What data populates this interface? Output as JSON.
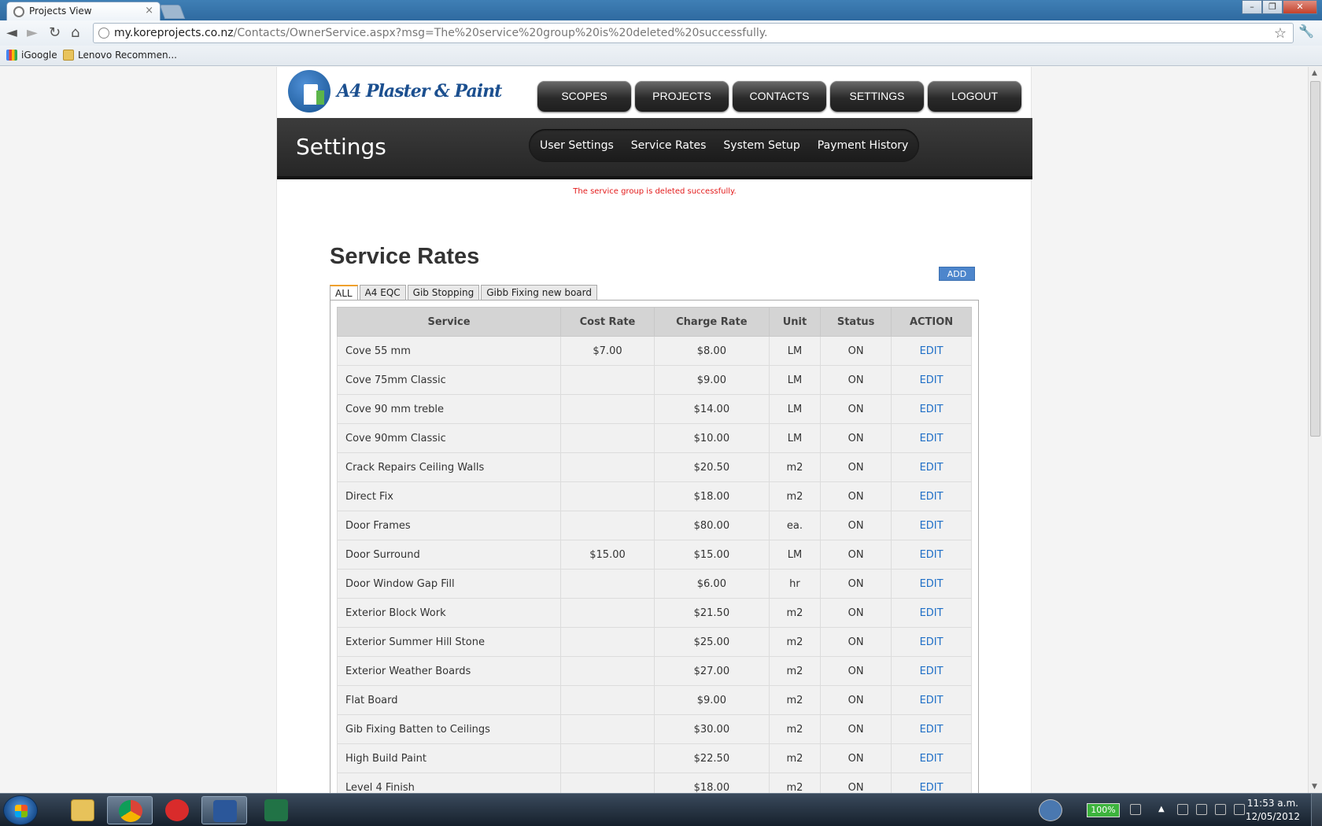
{
  "browser": {
    "tab_title": "Projects View",
    "tab_close": "×",
    "url_domain": "my.koreprojects.co.nz",
    "url_path": "/Contacts/OwnerService.aspx?msg=The%20service%20group%20is%20deleted%20successfully.",
    "bookmarks": [
      "iGoogle",
      "Lenovo Recommen..."
    ],
    "nav_icons": {
      "back": "◄",
      "forward": "►",
      "reload": "↻",
      "home": "⌂",
      "star": "☆",
      "wrench": "🔧"
    },
    "window_controls": [
      "–",
      "❐",
      "✕"
    ]
  },
  "site": {
    "logo_text": "A4 Plaster & Paint",
    "main_nav": [
      "SCOPES",
      "PROJECTS",
      "CONTACTS",
      "SETTINGS",
      "LOGOUT"
    ],
    "page_title": "Settings",
    "sub_nav": [
      "User Settings",
      "Service Rates",
      "System Setup",
      "Payment History"
    ],
    "message": "The service group is deleted successfully.",
    "message_color": "#e31b1b"
  },
  "rates": {
    "title": "Service Rates",
    "add_label": "ADD",
    "tabs": [
      "ALL",
      "A4 EQC",
      "Gib Stopping",
      "Gibb Fixing new board"
    ],
    "active_tab": "ALL",
    "columns": [
      "Service",
      "Cost Rate",
      "Charge Rate",
      "Unit",
      "Status",
      "ACTION"
    ],
    "rows": [
      {
        "service": "Cove 55 mm",
        "cost": "$7.00",
        "charge": "$8.00",
        "unit": "LM",
        "status": "ON",
        "action": "EDIT"
      },
      {
        "service": "Cove 75mm Classic",
        "cost": "",
        "charge": "$9.00",
        "unit": "LM",
        "status": "ON",
        "action": "EDIT"
      },
      {
        "service": "Cove 90 mm treble",
        "cost": "",
        "charge": "$14.00",
        "unit": "LM",
        "status": "ON",
        "action": "EDIT"
      },
      {
        "service": "Cove 90mm Classic",
        "cost": "",
        "charge": "$10.00",
        "unit": "LM",
        "status": "ON",
        "action": "EDIT"
      },
      {
        "service": "Crack Repairs Ceiling Walls",
        "cost": "",
        "charge": "$20.50",
        "unit": "m2",
        "status": "ON",
        "action": "EDIT"
      },
      {
        "service": "Direct Fix",
        "cost": "",
        "charge": "$18.00",
        "unit": "m2",
        "status": "ON",
        "action": "EDIT"
      },
      {
        "service": "Door Frames",
        "cost": "",
        "charge": "$80.00",
        "unit": "ea.",
        "status": "ON",
        "action": "EDIT"
      },
      {
        "service": "Door Surround",
        "cost": "$15.00",
        "charge": "$15.00",
        "unit": "LM",
        "status": "ON",
        "action": "EDIT"
      },
      {
        "service": "Door Window Gap Fill",
        "cost": "",
        "charge": "$6.00",
        "unit": "hr",
        "status": "ON",
        "action": "EDIT"
      },
      {
        "service": "Exterior Block Work",
        "cost": "",
        "charge": "$21.50",
        "unit": "m2",
        "status": "ON",
        "action": "EDIT"
      },
      {
        "service": "Exterior Summer Hill Stone",
        "cost": "",
        "charge": "$25.00",
        "unit": "m2",
        "status": "ON",
        "action": "EDIT"
      },
      {
        "service": "Exterior Weather Boards",
        "cost": "",
        "charge": "$27.00",
        "unit": "m2",
        "status": "ON",
        "action": "EDIT"
      },
      {
        "service": "Flat Board",
        "cost": "",
        "charge": "$9.00",
        "unit": "m2",
        "status": "ON",
        "action": "EDIT"
      },
      {
        "service": "Gib Fixing Batten to Ceilings",
        "cost": "",
        "charge": "$30.00",
        "unit": "m2",
        "status": "ON",
        "action": "EDIT"
      },
      {
        "service": "High Build Paint",
        "cost": "",
        "charge": "$22.50",
        "unit": "m2",
        "status": "ON",
        "action": "EDIT"
      },
      {
        "service": "Level 4 Finish",
        "cost": "",
        "charge": "$18.00",
        "unit": "m2",
        "status": "ON",
        "action": "EDIT"
      }
    ]
  },
  "taskbar": {
    "battery": "100%",
    "time": "11:53 a.m.",
    "date": "12/05/2012"
  }
}
